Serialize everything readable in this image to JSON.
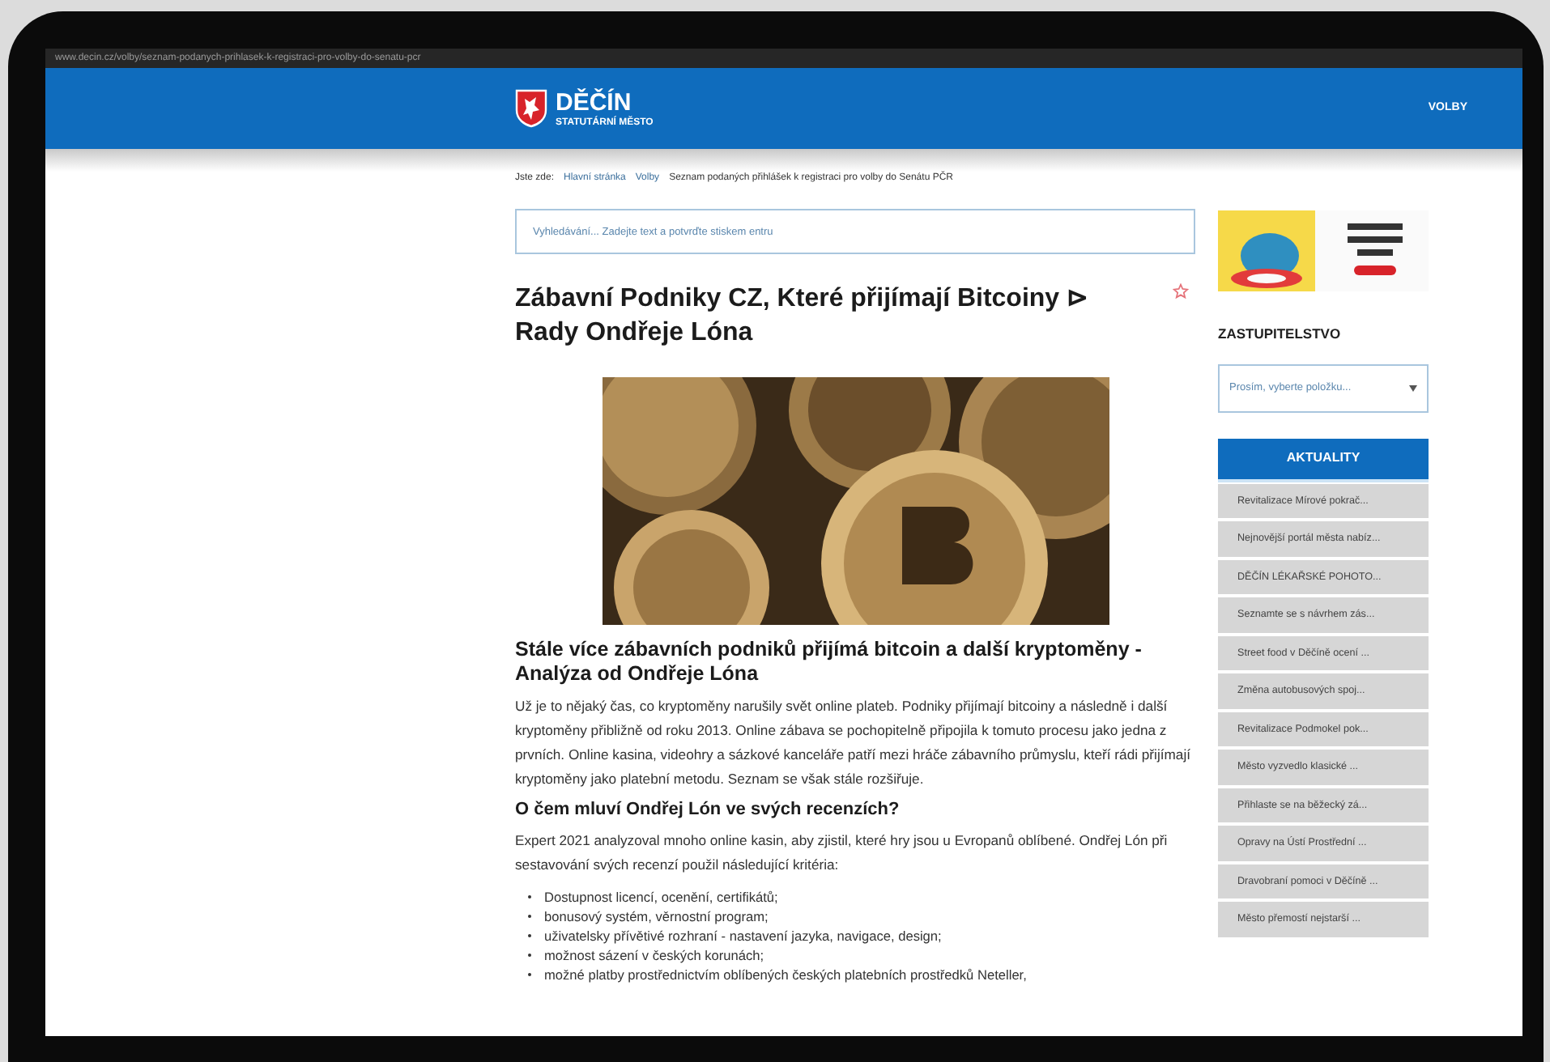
{
  "browser": {
    "url": "www.decin.cz/volby/seznam-podanych-prihlasek-k-registraci-pro-volby-do-senatu-pcr"
  },
  "header": {
    "logo_title": "DĚČÍN",
    "logo_subtitle": "STATUTÁRNÍ MĚSTO",
    "nav": [
      {
        "label": "VOLBY"
      }
    ]
  },
  "breadcrumb": [
    {
      "label": "Jste zde:",
      "kind": "prefix"
    },
    {
      "label": "Hlavní stránka",
      "kind": "link"
    },
    {
      "label": "Volby",
      "kind": "link"
    },
    {
      "label": "Seznam podaných přihlášek k registraci pro volby do Senátu PČR",
      "kind": "current"
    }
  ],
  "search": {
    "placeholder": "Vyhledávání... Zadejte text a potvrďte stiskem entru"
  },
  "article": {
    "title": "Zábavní Podniky CZ, Které přijímají Bitcoiny ⊳ Rady Ondřeje Lóna",
    "blocks": [
      {
        "kind": "heading",
        "text": "Stále více zábavních podniků přijímá bitcoin a další kryptoměny - Analýza od Ondřeje Lóna"
      },
      {
        "kind": "paragraph",
        "text": "Už je to nějaký čas, co kryptoměny narušily svět online plateb. Podniky přijímají bitcoiny a následně i další kryptoměny přibližně od roku 2013. Online zábava se pochopitelně připojila k tomuto procesu jako jedna z prvních. Online kasina, videohry a sázkové kanceláře patří mezi hráče zábavního průmyslu, kteří rádi přijímají kryptoměny jako platební metodu. Seznam se však stále rozšiřuje."
      },
      {
        "kind": "subheading",
        "text": "O čem mluví Ondřej Lón ve svých recenzích?"
      },
      {
        "kind": "paragraph",
        "text": "Expert 2021 analyzoval mnoho online kasin, aby zjistil, které hry jsou u Evropanů oblíbené. Ondřej Lón při sestavování svých recenzí použil následující kritéria:"
      },
      {
        "kind": "list",
        "items": [
          "Dostupnost licencí, ocenění, certifikátů;",
          "bonusový systém, věrnostní program;",
          "uživatelsky přívětivé rozhraní - nastavení jazyka, navigace, design;",
          "možnost sázení v českých korunách;",
          "možné platby prostřednictvím oblíbených českých platebních prostředků Neteller,"
        ]
      }
    ]
  },
  "sidebar": {
    "section_title": "ZASTUPITELSTVO",
    "select": {
      "placeholder": "Prosím, vyberte položku..."
    },
    "news": {
      "title": "AKTUALITY",
      "items": [
        "Revitalizace Mírové pokrač...",
        "Nejnovější portál města nabíz...",
        "DĚČÍN LÉKAŘSKÉ POHOTO...",
        "Seznamte se s návrhem zás...",
        "Street food v Děčíně ocení ...",
        "Změna autobusových spoj...",
        "Revitalizace Podmokel pok...",
        "Město vyzvedlo klasické ...",
        "Přihlaste se na běžecký zá...",
        "Opravy na Ústí Prostřední ...",
        "Dravobraní pomoci v Děčíně ...",
        "Město přemostí nejstarší ..."
      ]
    }
  }
}
